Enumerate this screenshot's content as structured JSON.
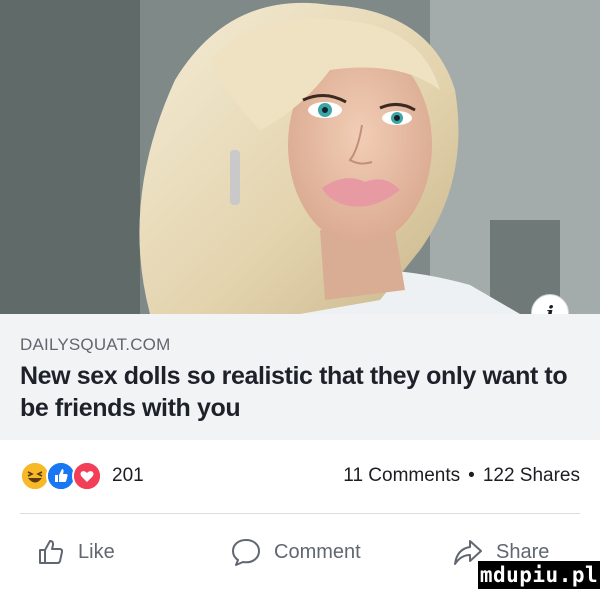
{
  "link_preview": {
    "domain": "DAILYSQUAT.COM",
    "title": "New sex dolls so realistic that they only want to be friends with you",
    "info_glyph": "i"
  },
  "stats": {
    "reactions": [
      "haha",
      "like",
      "love"
    ],
    "reaction_count": "201",
    "comments": "11 Comments",
    "separator": "•",
    "shares": "122 Shares"
  },
  "actions": {
    "like": "Like",
    "comment": "Comment",
    "share": "Share"
  },
  "watermark": "mdupiu.pl",
  "colors": {
    "like_blue": "#1877f2",
    "love_red": "#f33e58",
    "haha_yellow": "#f7b928",
    "caption_bg": "#f2f3f5",
    "secondary_text": "#606770"
  }
}
